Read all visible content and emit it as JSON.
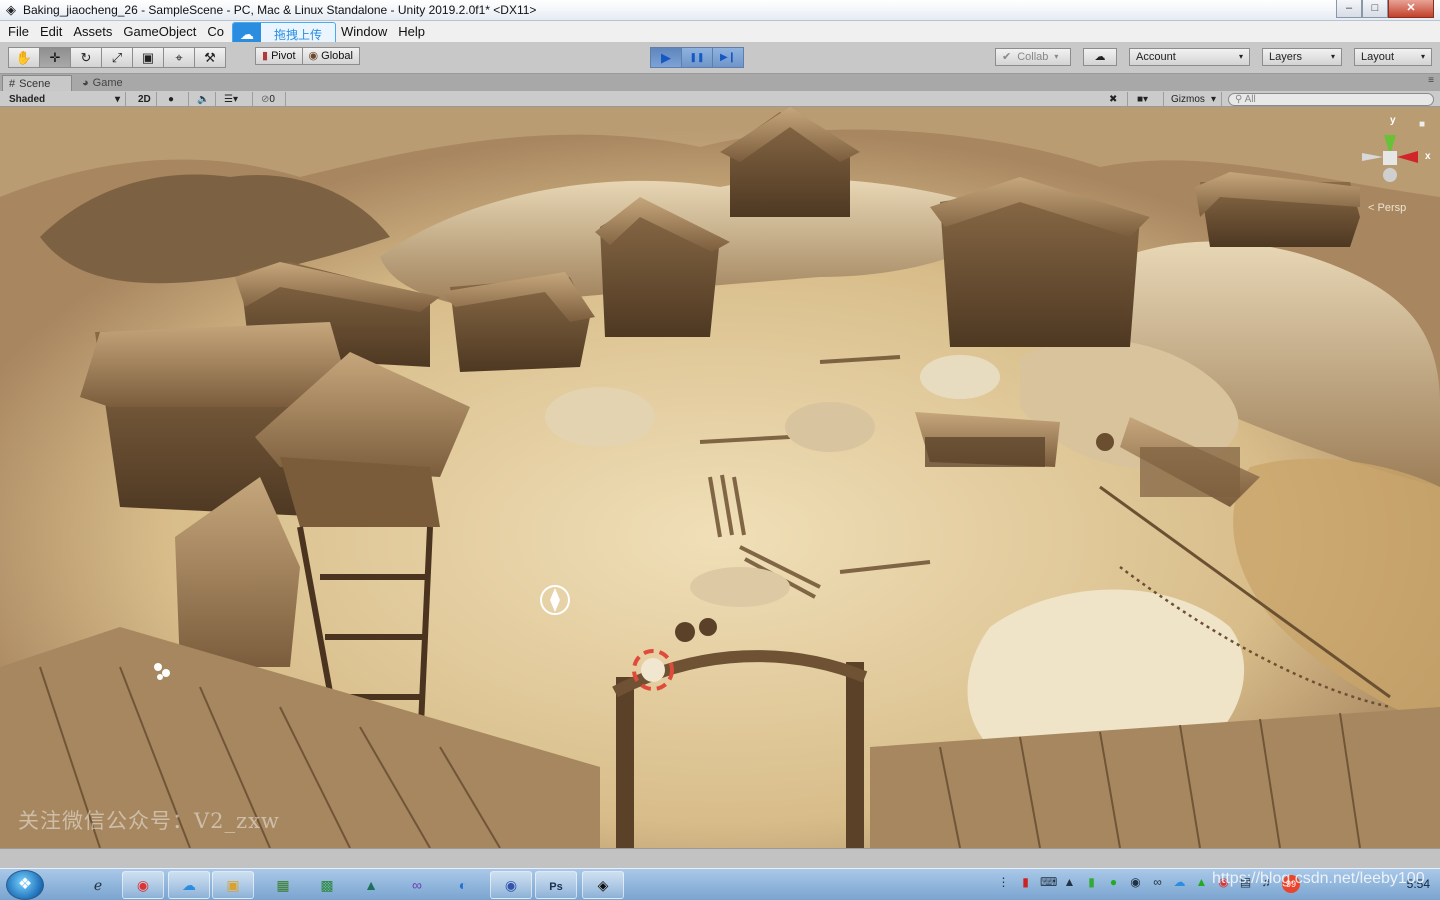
{
  "window": {
    "title": "Baking_jiaocheng_26 - SampleScene - PC, Mac & Linux Standalone - Unity 2019.2.0f1* <DX11>",
    "minimize": "–",
    "maximize": "□",
    "close": "✕"
  },
  "menu": {
    "items": [
      "File",
      "Edit",
      "Assets",
      "GameObject",
      "Co",
      "Window",
      "Help"
    ],
    "upload_label": "拖拽上传"
  },
  "toolbar": {
    "tools": [
      {
        "name": "hand-tool",
        "glyph": "✋"
      },
      {
        "name": "move-tool",
        "glyph": "✛"
      },
      {
        "name": "rotate-tool",
        "glyph": "↻"
      },
      {
        "name": "scale-tool",
        "glyph": "⤢"
      },
      {
        "name": "rect-tool",
        "glyph": "▣"
      },
      {
        "name": "transform-tool",
        "glyph": "⌖"
      },
      {
        "name": "custom-tool",
        "glyph": "⚒"
      }
    ],
    "pivot": "Pivot",
    "global": "Global",
    "play_glyph": "▶",
    "pause_glyph": "❚❚",
    "step_glyph": "▶❙",
    "collab": "Collab",
    "cloud_glyph": "☁",
    "account": "Account",
    "layers": "Layers",
    "layout": "Layout",
    "caret": "▾"
  },
  "tabs": {
    "scene": "Scene",
    "game": "Game",
    "menu_glyph": "≡"
  },
  "scene_bar": {
    "shading_mode": "Shaded",
    "mode_2d": "2D",
    "hidden_count": "0",
    "gizmos": "Gizmos",
    "search_placeholder": "All"
  },
  "viewport": {
    "projection": "Persp",
    "axis_y": "y",
    "axis_x": "x",
    "watermark": "关注微信公众号：V2_zxw"
  },
  "taskbar": {
    "clock": "5:54",
    "badge": "99",
    "overlay_url": "https://blog.csdn.net/leeby100"
  }
}
